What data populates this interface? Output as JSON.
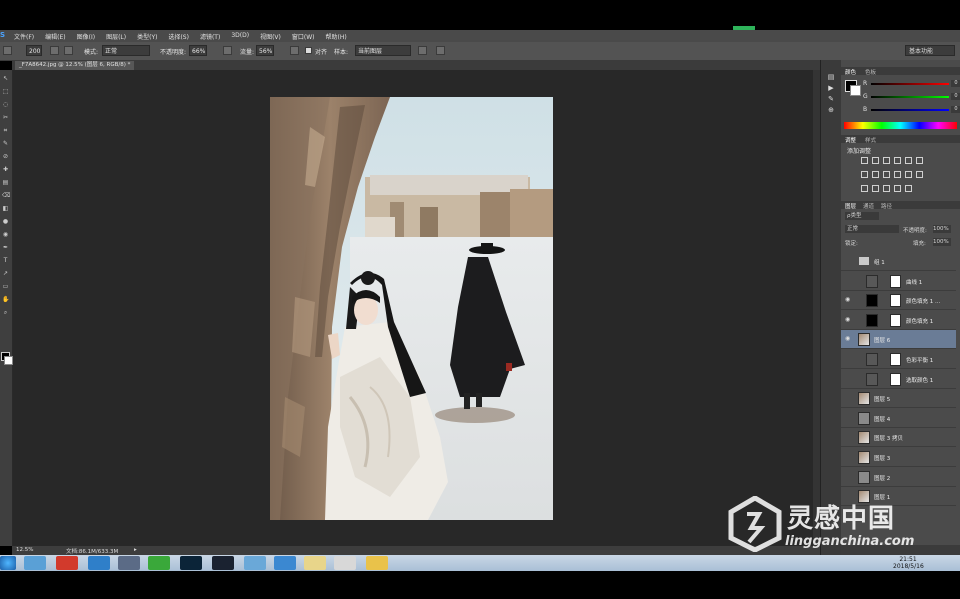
{
  "app": {
    "logo_letter": "S"
  },
  "menu": [
    "文件(F)",
    "编辑(E)",
    "图像(I)",
    "图层(L)",
    "类型(Y)",
    "选择(S)",
    "滤镜(T)",
    "3D(D)",
    "视图(V)",
    "窗口(W)",
    "帮助(H)"
  ],
  "options": {
    "brush_size": "200",
    "mode_label": "模式:",
    "mode_value": "正常",
    "opacity_label": "不透明度:",
    "opacity_value": "66%",
    "flow_label": "流量:",
    "flow_value": "56%",
    "align_label": "对齐",
    "sample_label": "样本:",
    "sample_value": "当前图层",
    "workspace": "基本功能"
  },
  "document": {
    "tab_title": "_F7A8642.jpg @ 12.5% (图层 6, RGB/8) *",
    "zoom": "12.5%",
    "doc_size": "文档:86.1M/633.3M"
  },
  "color_panel": {
    "tabs": [
      "颜色",
      "色板"
    ],
    "channels": [
      {
        "label": "R",
        "value": "0"
      },
      {
        "label": "G",
        "value": "0"
      },
      {
        "label": "B",
        "value": "0"
      }
    ]
  },
  "adjust_panel": {
    "tabs": [
      "调整",
      "样式"
    ],
    "title": "添加调整"
  },
  "layers_panel": {
    "tabs": [
      "图层",
      "通道",
      "路径"
    ],
    "filter_label": "ρ类型",
    "blend_mode": "正常",
    "opacity_label": "不透明度:",
    "opacity_value": "100%",
    "lock_label": "锁定:",
    "fill_label": "填充:",
    "fill_value": "100%",
    "layers": [
      {
        "name": "组 1",
        "type": "group"
      },
      {
        "name": "曲线 1",
        "type": "adjust"
      },
      {
        "name": "颜色填充 1 ...",
        "type": "fill"
      },
      {
        "name": "颜色填充 1",
        "type": "fill"
      },
      {
        "name": "图层 6",
        "type": "image",
        "selected": true
      },
      {
        "name": "色彩平衡 1",
        "type": "adjust"
      },
      {
        "name": "选取颜色 1",
        "type": "adjust"
      },
      {
        "name": "图层 5",
        "type": "image"
      },
      {
        "name": "图层 4",
        "type": "gray"
      },
      {
        "name": "图层 3 拷贝",
        "type": "image"
      },
      {
        "name": "图层 3",
        "type": "image"
      },
      {
        "name": "图层 2",
        "type": "gray"
      },
      {
        "name": "图层 1",
        "type": "image"
      }
    ]
  },
  "taskbar": {
    "time": "21:51",
    "date": "2018/5/16"
  },
  "watermark": {
    "title": "灵感中国",
    "subtitle": "lingganchina.com"
  }
}
